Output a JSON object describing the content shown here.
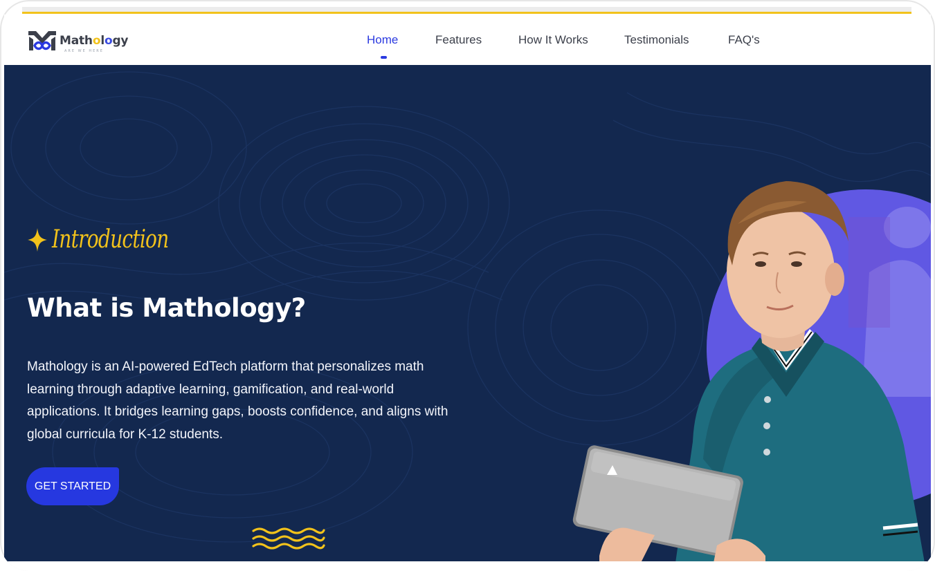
{
  "brand": {
    "name_parts": [
      "Math",
      "o",
      "l",
      "o",
      "gy"
    ],
    "tagline": "ARE WE HERE"
  },
  "nav": {
    "items": [
      {
        "label": "Home",
        "active": true
      },
      {
        "label": "Features",
        "active": false
      },
      {
        "label": "How It Works",
        "active": false
      },
      {
        "label": "Testimonials",
        "active": false
      },
      {
        "label": "FAQ's",
        "active": false
      }
    ]
  },
  "hero": {
    "eyebrow": "Introduction",
    "title": "What is Mathology?",
    "description": "Mathology is an AI-powered EdTech platform that personalizes math learning through adaptive learning, gamification, and real-world applications. It bridges learning gaps, boosts confidence, and aligns with global curricula for K-12 students.",
    "cta_label": "GET STARTED"
  },
  "colors": {
    "hero_bg": "#13284f",
    "accent_yellow": "#f2c21b",
    "primary_blue": "#2638e0",
    "nav_text": "#3b3f4a"
  },
  "icons": {
    "eyebrow": "sparkle-star-icon",
    "decoration": "wavy-lines-icon"
  }
}
